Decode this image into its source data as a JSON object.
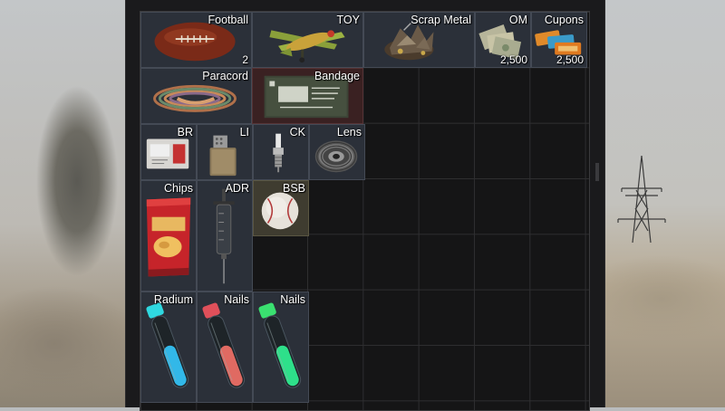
{
  "inventory": {
    "items": [
      {
        "key": "football",
        "name": "Football",
        "count": "2"
      },
      {
        "key": "toy",
        "name": "TOY"
      },
      {
        "key": "scrap_metal",
        "name": "Scrap Metal"
      },
      {
        "key": "om",
        "name": "OM",
        "count": "2,500"
      },
      {
        "key": "cupons",
        "name": "Cupons",
        "count": "2,500"
      },
      {
        "key": "paracord",
        "name": "Paracord"
      },
      {
        "key": "bandage",
        "name": "Bandage"
      },
      {
        "key": "br",
        "name": "BR"
      },
      {
        "key": "li",
        "name": "LI"
      },
      {
        "key": "ck",
        "name": "CK"
      },
      {
        "key": "lens",
        "name": "Lens"
      },
      {
        "key": "chips",
        "name": "Chips"
      },
      {
        "key": "adr",
        "name": "ADR"
      },
      {
        "key": "bsb",
        "name": "BSB"
      },
      {
        "key": "radium",
        "name": "Radium"
      },
      {
        "key": "nails_red",
        "name": "Nails"
      },
      {
        "key": "nails_green",
        "name": "Nails"
      }
    ]
  },
  "icons": {
    "football": "football-icon",
    "toy": "toy-plane-icon",
    "scrap_metal": "scrap-metal-icon",
    "om": "banknotes-icon",
    "cupons": "coupons-icon",
    "paracord": "rope-coil-icon",
    "bandage": "bandage-pack-icon",
    "br": "battery-pack-icon",
    "li": "lighter-icon",
    "ck": "spark-plug-icon",
    "lens": "camera-lens-icon",
    "chips": "chips-bag-icon",
    "adr": "syringe-icon",
    "bsb": "baseball-icon",
    "radium": "vial-cyan-icon",
    "nails_red": "vial-red-icon",
    "nails_green": "vial-green-icon"
  },
  "colors": {
    "panel_bg": "#1a1a1c",
    "slot_bg": "#2b3039",
    "slot_red_bg": "#3a2122",
    "slot_olive_bg": "#3f3c30",
    "label_text": "#ffffff"
  }
}
